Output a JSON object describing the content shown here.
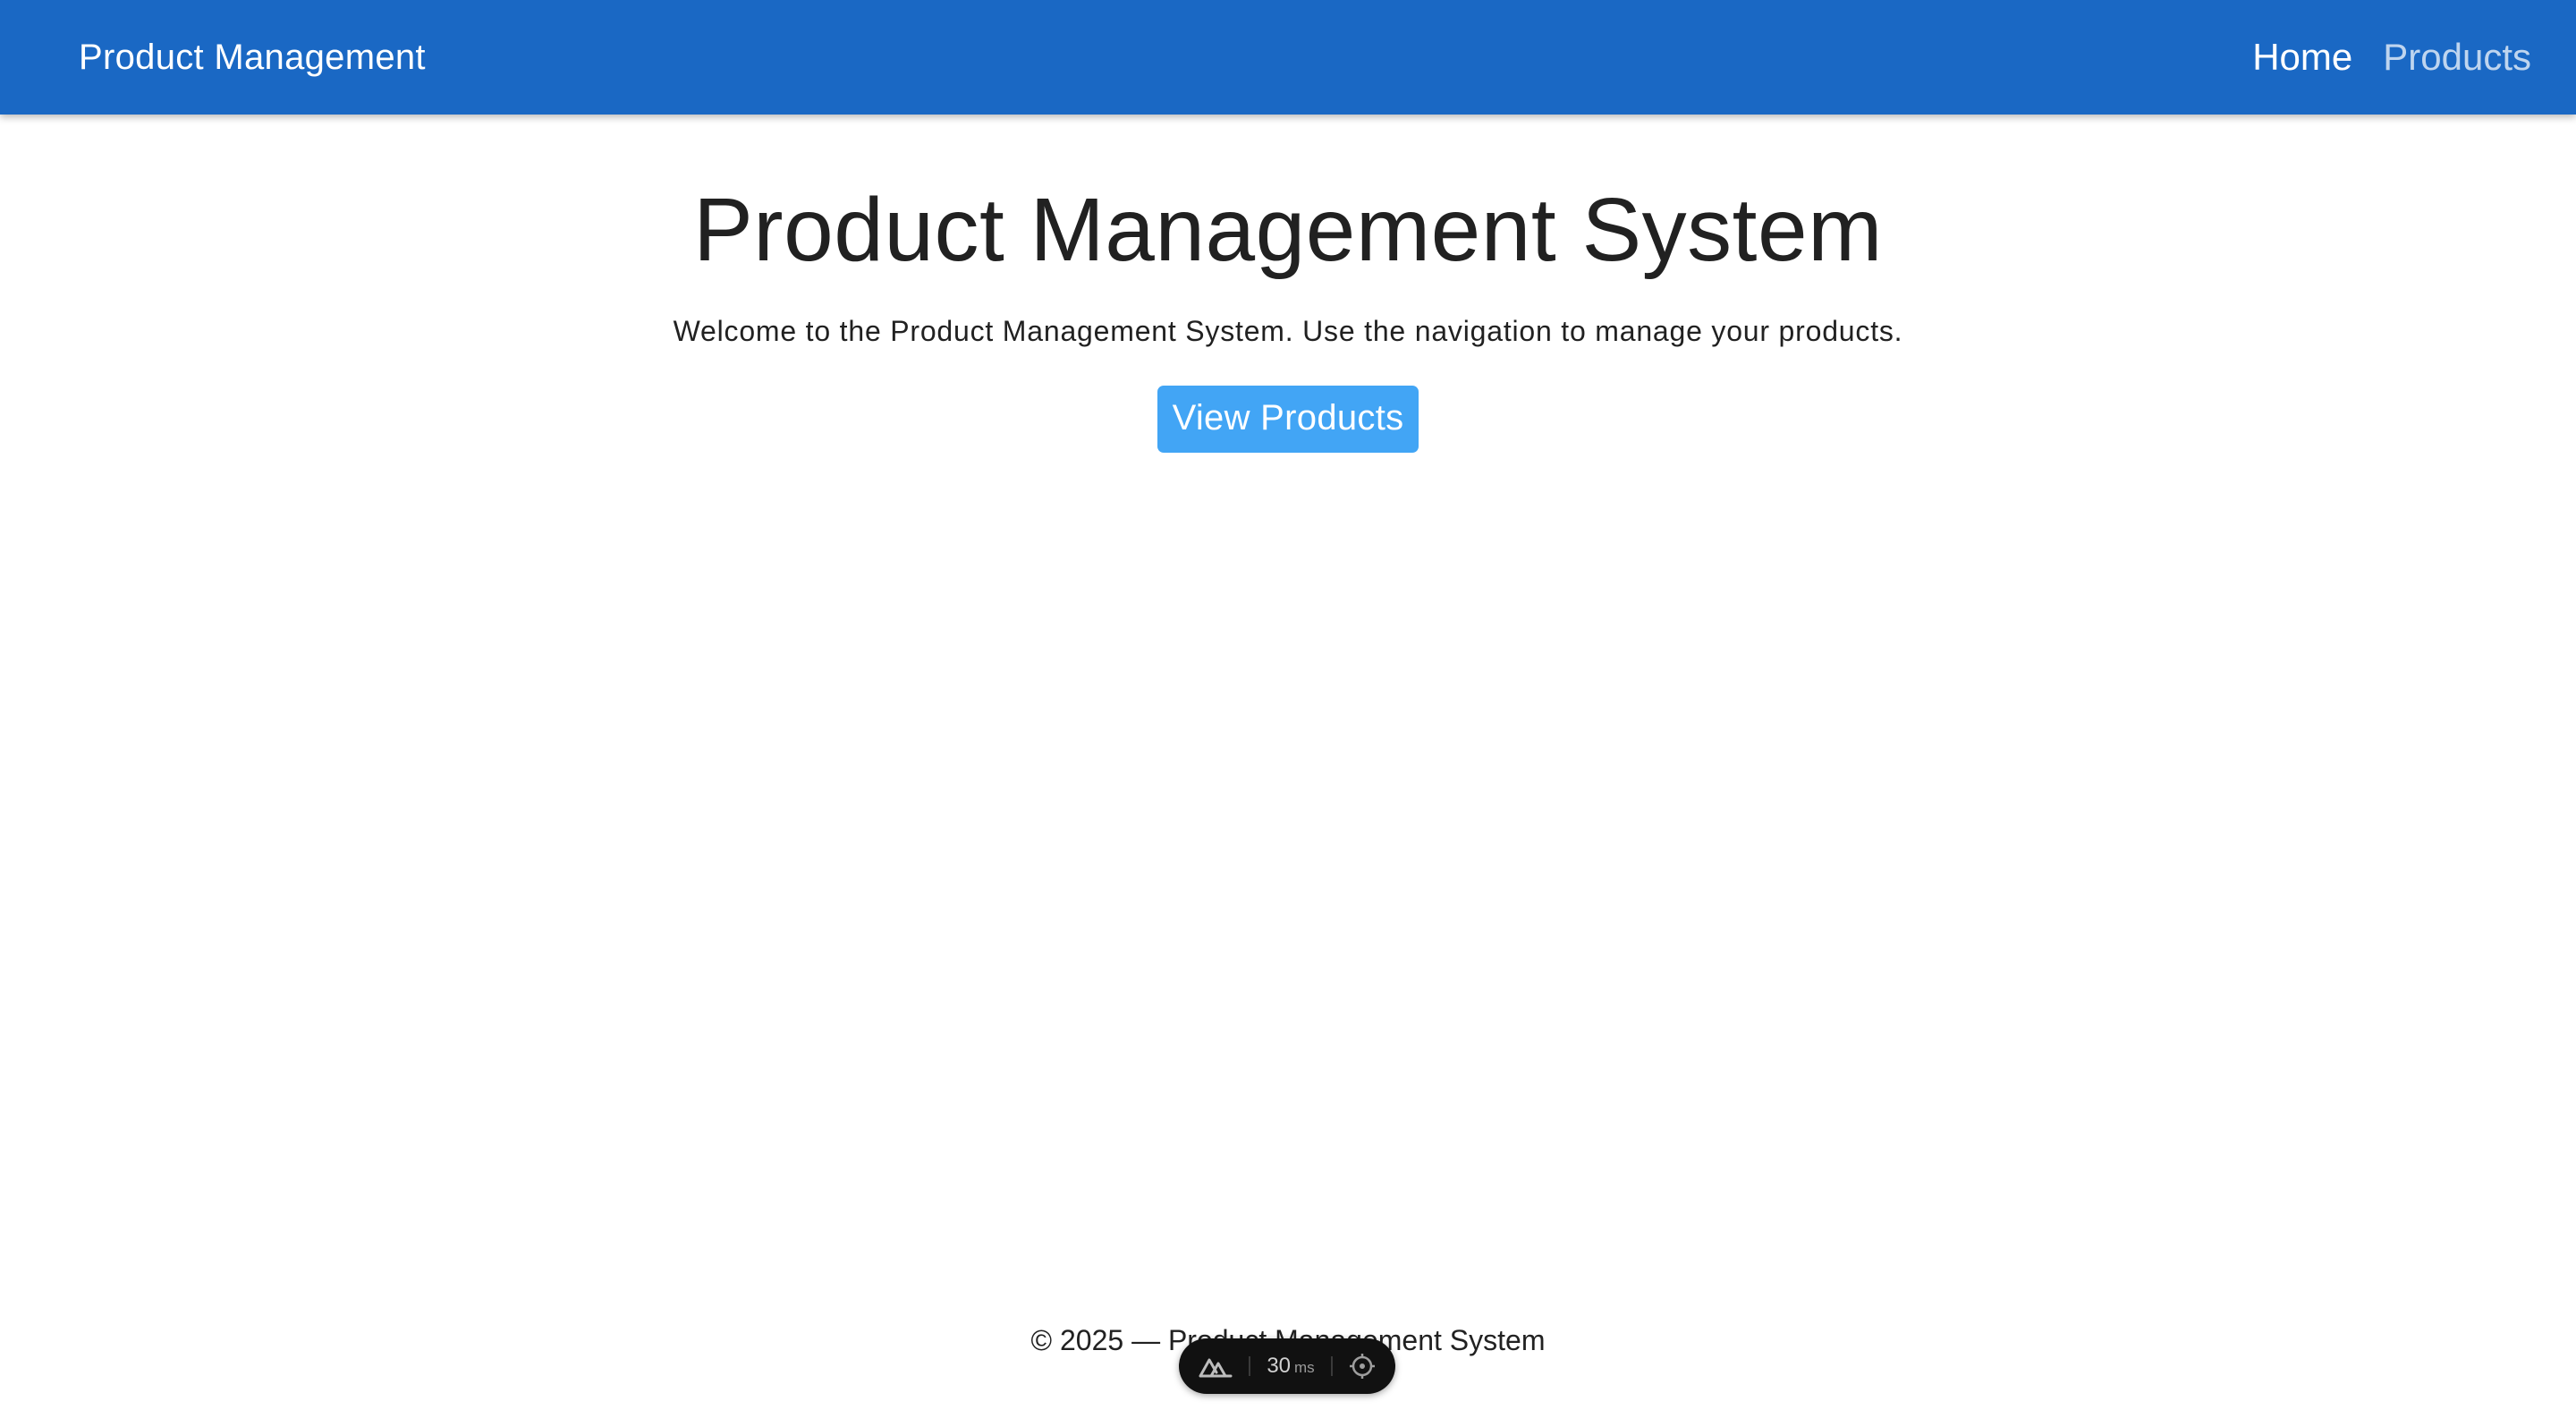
{
  "header": {
    "brand": "Product Management",
    "nav": [
      {
        "label": "Home",
        "active": true
      },
      {
        "label": "Products",
        "active": false
      }
    ]
  },
  "main": {
    "title": "Product Management System",
    "welcome": "Welcome to the Product Management System. Use the navigation to manage your products.",
    "cta_label": "View Products"
  },
  "footer": {
    "text": "© 2025 — Product Management System"
  },
  "devtools": {
    "timing_value": "30",
    "timing_unit": "ms",
    "left_icon": "nuxt-logo-icon",
    "right_icon": "crosshair-icon"
  },
  "colors": {
    "app_bar": "#1a68c4",
    "button": "#42a5f5",
    "text": "#212121"
  }
}
